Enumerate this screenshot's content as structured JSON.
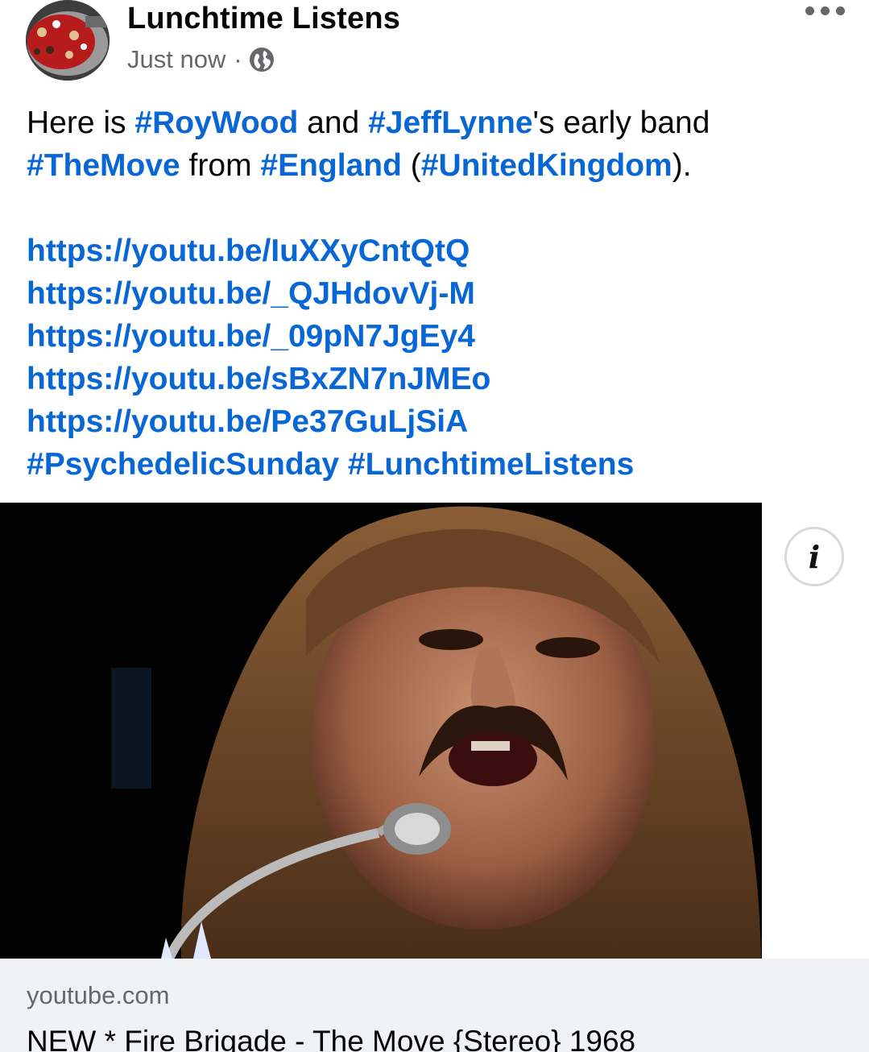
{
  "post": {
    "author": "Lunchtime Listens",
    "timestamp": "Just now",
    "separator": "·",
    "privacy_icon": "globe-icon",
    "more_icon": "more-horizontal-icon",
    "text": {
      "l1_a": "Here is ",
      "l1_tag1": "#RoyWood",
      "l1_b": " and ",
      "l1_tag2": "#JeffLynne",
      "l1_c": "'s early band",
      "l2_tag1": "#TheMove",
      "l2_a": " from ",
      "l2_tag2": "#England",
      "l2_b": " (",
      "l2_tag3": "#UnitedKingdom",
      "l2_c": ")."
    },
    "links": [
      "https://youtu.be/IuXXyCntQtQ",
      "https://youtu.be/_QJHdovVj-M",
      "https://youtu.be/_09pN7JgEy4",
      "https://youtu.be/sBxZN7nJMEo",
      "https://youtu.be/Pe37GuLjSiA"
    ],
    "hashtags": [
      "#PsychedelicSunday",
      "#LunchtimeListens"
    ]
  },
  "media": {
    "info_label": "i"
  },
  "link_card": {
    "domain": "youtube.com",
    "title": "NEW * Fire Brigade - The Move {Stereo} 1968"
  },
  "colors": {
    "link": "#0866d5",
    "meta": "#65676b",
    "card_bg": "#f0f2f5"
  }
}
